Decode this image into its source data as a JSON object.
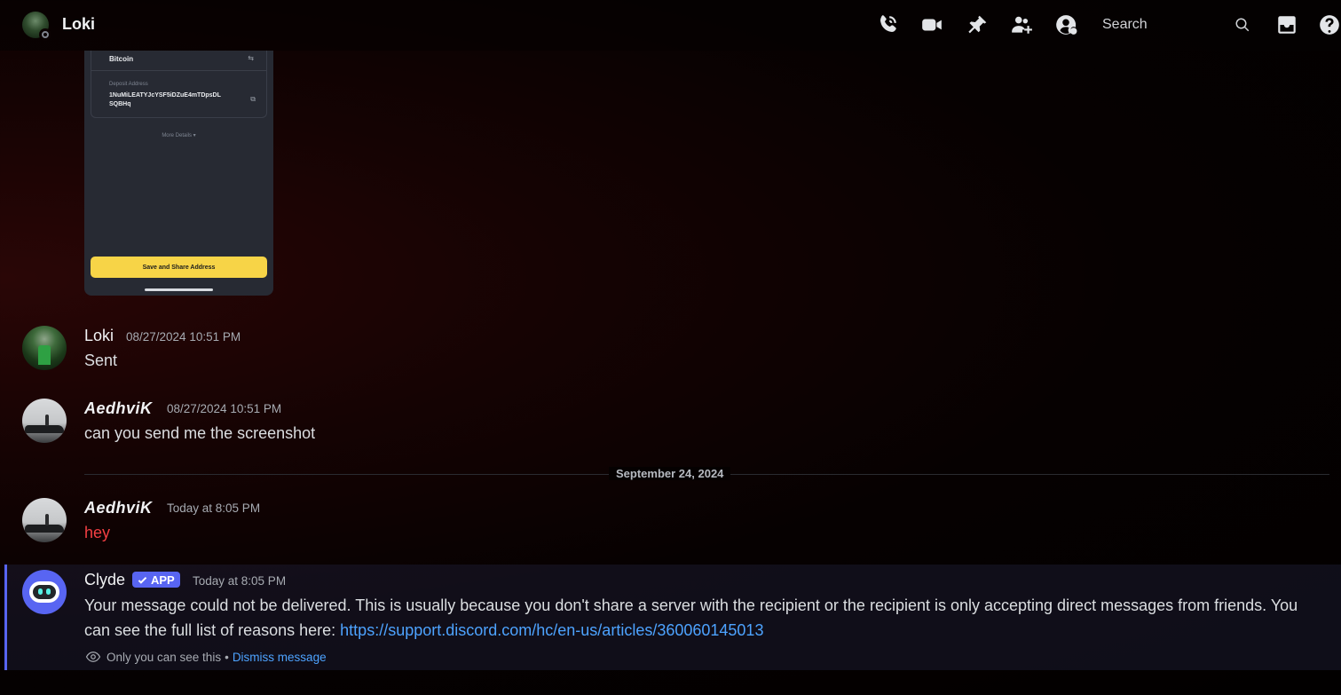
{
  "header": {
    "title": "Loki",
    "search_placeholder": "Search",
    "icons": [
      "phone-call-icon",
      "video-icon",
      "pin-icon",
      "add-friend-icon",
      "user-profile-icon",
      "search-icon",
      "inbox-icon",
      "help-icon"
    ]
  },
  "embed": {
    "coin": "Bitcoin",
    "swap_glyph": "⇆",
    "deposit_label": "Deposit Address",
    "address": "1NuMiLEATYJcYSF5iDZuE4mTDpsDLSQBHq",
    "copy_glyph": "⧉",
    "more_details": "More Details ▾",
    "save_button": "Save and Share Address"
  },
  "messages": [
    {
      "author": "Loki",
      "timestamp": "08/27/2024 10:51 PM",
      "text": "Sent"
    },
    {
      "author": "AedhviK",
      "timestamp": "08/27/2024 10:51 PM",
      "text": "can you send me the screenshot"
    },
    {
      "author": "AedhviK",
      "timestamp": "Today at 8:05 PM",
      "text": "hey"
    }
  ],
  "date_separator": "September 24, 2024",
  "clyde": {
    "author": "Clyde",
    "badge": "APP",
    "timestamp": "Today at 8:05 PM",
    "text": "Your message could not be delivered. This is usually because you don't share a server with the recipient or the recipient is only accepting direct messages from friends. You can see the full list of reasons here: ",
    "link": "https://support.discord.com/hc/en-us/articles/360060145013",
    "only_you": "Only you can see this",
    "bullet": "•",
    "dismiss": "Dismiss message"
  },
  "colors": {
    "accent": "#5865f2",
    "link": "#4da3ff",
    "error_text": "#f23f43",
    "embed_button": "#f7d447"
  }
}
